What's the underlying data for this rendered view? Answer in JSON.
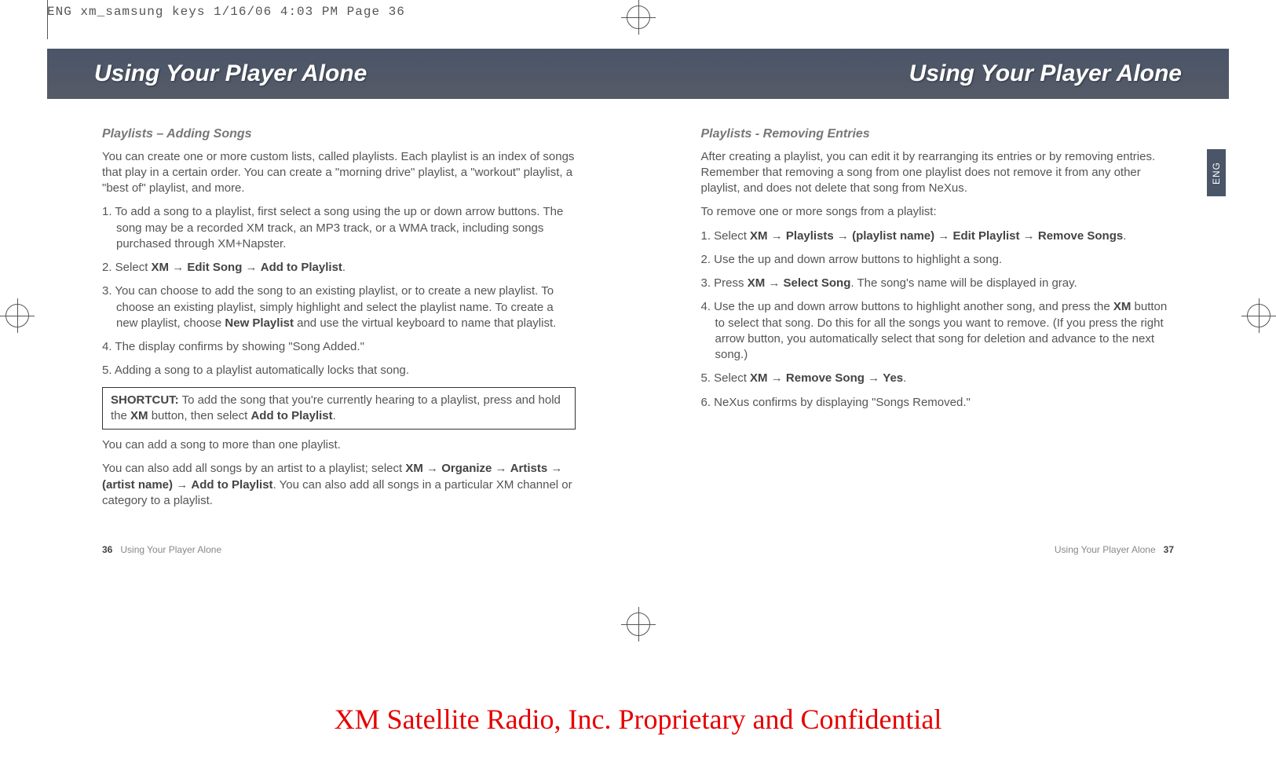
{
  "slug": "ENG xm_samsung keys  1/16/06  4:03 PM  Page 36",
  "banner_left": "Using Your Player Alone",
  "banner_right": "Using Your Player Alone",
  "eng_tab": "ENG",
  "left": {
    "subhead": "Playlists – Adding Songs",
    "intro": "You can create one or more custom lists, called playlists. Each playlist is an index of songs that play in a certain order. You can create a \"morning drive\" playlist, a \"workout\" playlist, a \"best of\" playlist, and more.",
    "s1": "1. To add a song to a playlist, first select a song using the up or down arrow buttons. The song may be a recorded XM track, an MP3 track, or a WMA track, including songs purchased through XM+Napster.",
    "s2a": "2. Select ",
    "s2b": "XM",
    "s2c": " → ",
    "s2d": "Edit Song",
    "s2e": " → ",
    "s2f": "Add to Playlist",
    "s2g": ".",
    "s3a": "3. You can choose to add the song to an existing playlist, or to create a new playlist. To choose an existing playlist, simply highlight and select the playlist name. To create a new playlist, choose ",
    "s3b": "New Playlist",
    "s3c": " and use the virtual keyboard to name that playlist.",
    "s4": "4. The display confirms by showing \"Song Added.\"",
    "s5": "5. Adding a song to a playlist automatically locks that song.",
    "sh_a": "SHORTCUT:",
    "sh_b": " To add the song that you're currently hearing to a playlist, press and hold the ",
    "sh_c": "XM",
    "sh_d": " button, then select ",
    "sh_e": "Add to Playlist",
    "sh_f": ".",
    "p6": "You can add a song to more than one playlist.",
    "p7a": "You can also add all songs by an artist to a playlist; select ",
    "p7b": "XM",
    "p7c": " → ",
    "p7d": "Organize",
    "p7e": " → ",
    "p7f": "Artists",
    "p7g": " → ",
    "p7h": "(artist name)",
    "p7i": " → ",
    "p7j": "Add to Playlist",
    "p7k": ". You can also add all songs in a particular XM channel or category to a playlist."
  },
  "right": {
    "subhead": "Playlists - Removing Entries",
    "intro": "After creating a playlist, you can edit it by rearranging its entries or by removing entries. Remember that removing a song from one playlist does not remove it from any other playlist, and does not delete that song from NeXus.",
    "lead": "To remove one or more songs from a playlist:",
    "s1a": "1. Select ",
    "s1b": "XM",
    "s1c": " → ",
    "s1d": "Playlists",
    "s1e": " → ",
    "s1f": "(playlist name)",
    "s1g": " → ",
    "s1h": "Edit Playlist",
    "s1i": " → ",
    "s1j": "Remove Songs",
    "s1k": ".",
    "s2": "2. Use the up and down arrow buttons to highlight a song.",
    "s3a": "3. Press ",
    "s3b": "XM",
    "s3c": " → ",
    "s3d": "Select Song",
    "s3e": ". The song's name will be displayed in gray.",
    "s4a": "4. Use the up and down arrow buttons to highlight another song, and press the ",
    "s4b": "XM",
    "s4c": " button to select that song. Do this for all the songs you want to remove. (If you press the right arrow button, you automatically select that song for deletion and advance to the next song.)",
    "s5a": "5. Select ",
    "s5b": "XM",
    "s5c": " → ",
    "s5d": "Remove Song",
    "s5e": " → ",
    "s5f": "Yes",
    "s5g": ".",
    "s6": "6. NeXus confirms by displaying \"Songs Removed.\""
  },
  "footer_l_num": "36",
  "footer_l_txt": "Using Your Player Alone",
  "footer_r_txt": "Using Your Player Alone",
  "footer_r_num": "37",
  "confidential": "XM Satellite Radio, Inc. Proprietary and Confidential"
}
